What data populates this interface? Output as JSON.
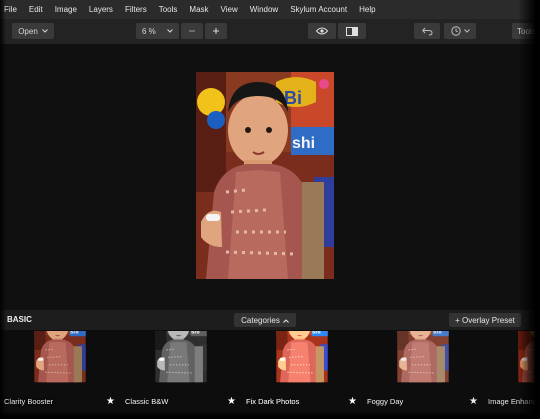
{
  "menubar": {
    "items": [
      "File",
      "Edit",
      "Image",
      "Layers",
      "Filters",
      "Tools",
      "Mask",
      "View",
      "Window",
      "Skylum Account",
      "Help"
    ]
  },
  "toolbar": {
    "open_label": "Open",
    "zoom_value": "6 %",
    "tools_label": "Tools"
  },
  "presets": {
    "section_label": "BASIC",
    "categories_label": "Categories",
    "overlay_label": "+ Overlay Preset",
    "items": [
      {
        "name": "Clarity Booster",
        "style": "clarity"
      },
      {
        "name": "Classic B&W",
        "style": "bw"
      },
      {
        "name": "Fix Dark Photos",
        "style": "bright"
      },
      {
        "name": "Foggy Day",
        "style": "foggy"
      },
      {
        "name": "Image Enhancer",
        "style": "enhance"
      }
    ]
  },
  "icons": {
    "open_dropdown": "chevron-down-icon",
    "zoom_dropdown": "chevron-down-icon",
    "zoom_out": "minus-icon",
    "zoom_in": "plus-icon",
    "preview": "eye-icon",
    "compare": "compare-icon",
    "undo": "undo-icon",
    "history": "clock-icon",
    "categories": "chevron-up-icon",
    "favorite": "star-icon"
  },
  "colors": {
    "background": "#101010",
    "menubar": "#2b2b2b",
    "toolbar": "#232323",
    "button": "#3a3a3a"
  }
}
